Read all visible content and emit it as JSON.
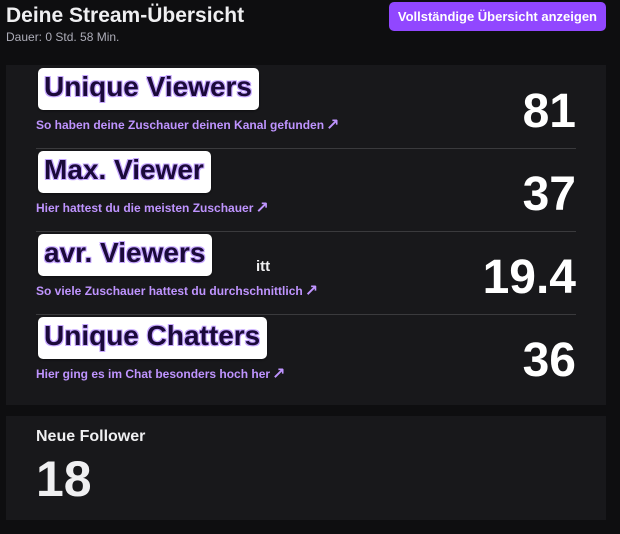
{
  "header": {
    "title": "Deine Stream-Übersicht",
    "duration": "Dauer: 0 Std. 58 Min.",
    "full_overview_button": "Vollständige Übersicht anzeigen"
  },
  "stats": [
    {
      "overlay_label": "Unique Viewers",
      "hidden_label": "",
      "subtitle": "So haben deine Zuschauer deinen Kanal gefunden",
      "arrow": "↗",
      "value": "81"
    },
    {
      "overlay_label": "Max. Viewer",
      "hidden_label": "",
      "subtitle": "Hier hattest du die meisten Zuschauer",
      "arrow": "↗",
      "value": "37"
    },
    {
      "overlay_label": "avr. Viewers",
      "hidden_label": "itt",
      "subtitle": "So viele Zuschauer hattest du durchschnittlich",
      "arrow": "↗",
      "value": "19.4"
    },
    {
      "overlay_label": "Unique Chatters",
      "hidden_label": "",
      "subtitle": "Hier ging es im Chat besonders hoch her",
      "arrow": "↗",
      "value": "36"
    }
  ],
  "followers": {
    "label": "Neue Follower",
    "value": "18"
  },
  "colors": {
    "background": "#0e0e10",
    "panel": "#18181b",
    "accent": "#9147ff",
    "link": "#bf94ff",
    "overlay_text": "#1b0a3a"
  }
}
